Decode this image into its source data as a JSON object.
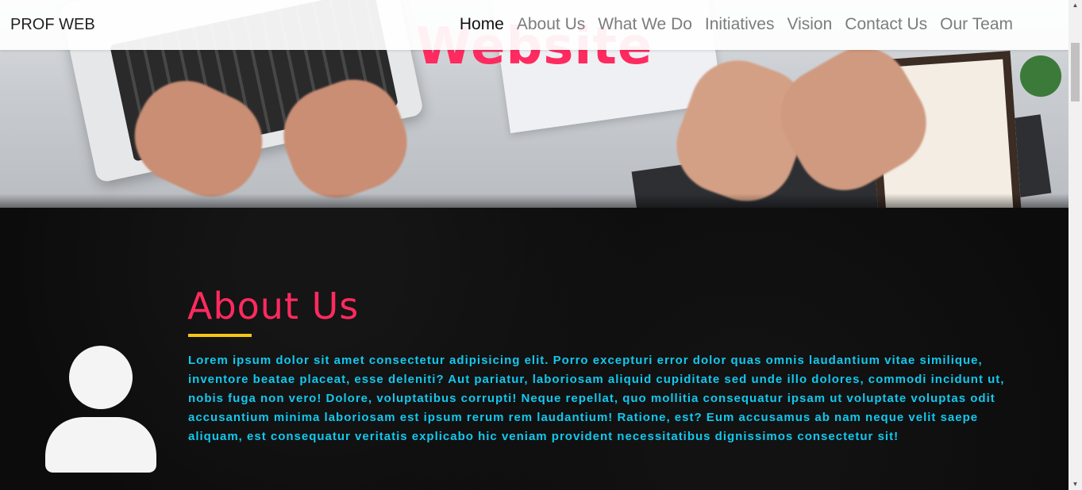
{
  "navbar": {
    "brand": "PROF WEB",
    "links": [
      "Home",
      "About Us",
      "What We Do",
      "Initiatives",
      "Vision",
      "Contact Us",
      "Our Team"
    ],
    "active": "Home"
  },
  "hero": {
    "title": "Website"
  },
  "about": {
    "title": "About Us",
    "text": "Lorem ipsum dolor sit amet consectetur adipisicing elit. Porro excepturi error dolor quas omnis laudantium vitae similique, inventore beatae placeat, esse deleniti? Aut pariatur, laboriosam aliquid cupiditate sed unde illo dolores, commodi incidunt ut, nobis fuga non vero! Dolore, voluptatibus corrupti! Neque repellat, quo mollitia consequatur ipsam ut voluptate voluptas odit accusantium minima laboriosam est ipsum rerum rem laudantium! Ratione, est? Eum accusamus ab nam neque velit saepe aliquam, est consequatur veritatis explicabo hic veniam provident necessitatibus dignissimos consectetur sit!",
    "avatar_icon": "user-icon"
  },
  "colors": {
    "accent_pink": "#ff2a5f",
    "accent_yellow": "#f5c518",
    "text_cyan": "#12c8ef",
    "section_bg": "#0c0c0c"
  }
}
